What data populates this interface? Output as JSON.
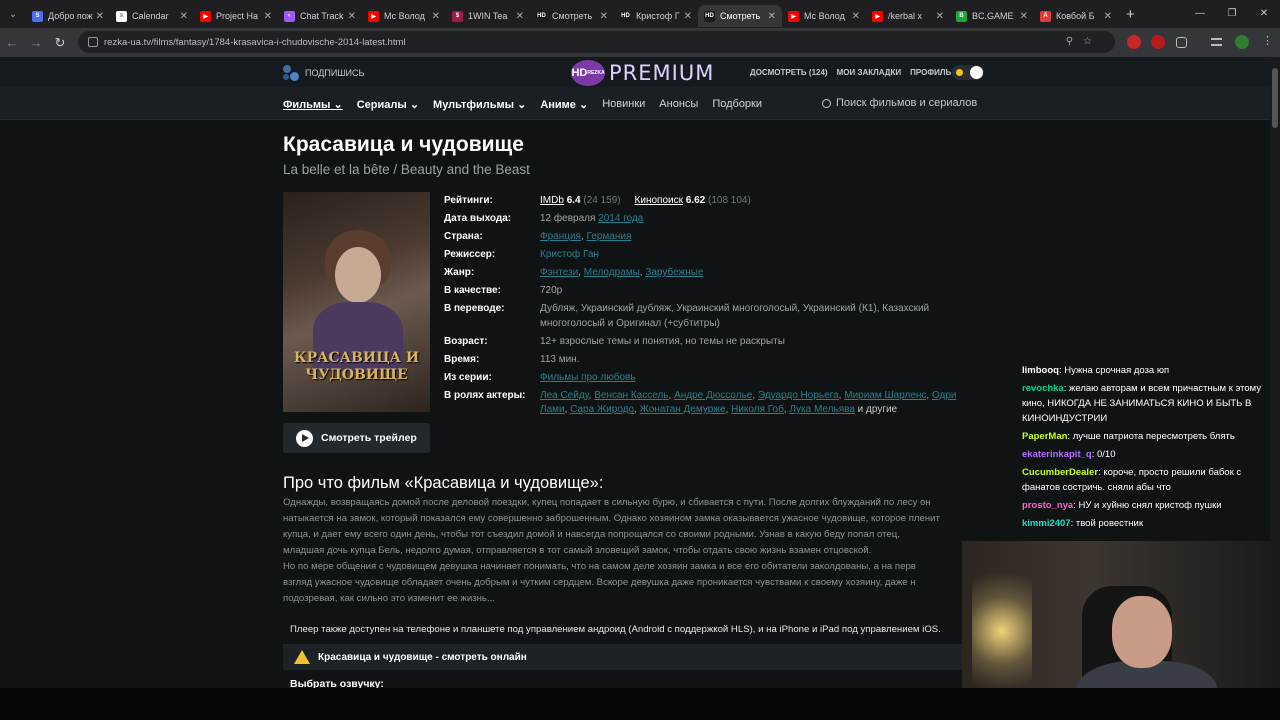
{
  "browser": {
    "tabs": [
      {
        "title": "Добро пож",
        "color": "#4c6ef5",
        "letter": "S"
      },
      {
        "title": "Calendar",
        "color": "#ffffff",
        "letter": "≡"
      },
      {
        "title": "Project Ha",
        "color": "#ff0000",
        "letter": "▶"
      },
      {
        "title": "Chat Track",
        "color": "#9c59ff",
        "letter": "◐"
      },
      {
        "title": "Мс Волод",
        "color": "#ff0000",
        "letter": "▶"
      },
      {
        "title": "1WIN Tea",
        "color": "#9e1b4a",
        "letter": "$"
      },
      {
        "title": "Смотреть",
        "color": "#1a1a1a",
        "letter": "HD"
      },
      {
        "title": "Кристоф Г",
        "color": "#1a1a1a",
        "letter": "HD"
      },
      {
        "title": "Смотреть",
        "color": "#1a1a1a",
        "letter": "HD",
        "active": true
      },
      {
        "title": "Мс Волод",
        "color": "#ff0000",
        "letter": "▶"
      },
      {
        "title": "/kerbal x",
        "color": "#ff0000",
        "letter": "▶"
      },
      {
        "title": "BC.GAME",
        "color": "#1fa83a",
        "letter": "B"
      },
      {
        "title": "Ковбой Б",
        "color": "#e53935",
        "letter": "A"
      }
    ],
    "url": "rezka-ua.tv/films/fantasy/1784-krasavica-i-chudovische-2014-latest.html"
  },
  "site": {
    "subscribe": "ПОДПИШИСЬ",
    "logo_hd": "HD",
    "logo_sub": "REZKA",
    "logo_premium": "PREMIUM",
    "toplinks": [
      "ДОСМОТРЕТЬ (124)",
      "МОИ ЗАКЛАДКИ",
      "ПРОФИЛЬ"
    ],
    "nav": [
      "Фильмы",
      "Сериалы",
      "Мультфильмы",
      "Аниме",
      "Новинки",
      "Анонсы",
      "Подборки"
    ],
    "search_placeholder": "Поиск фильмов и сериалов"
  },
  "movie": {
    "title": "Красавица и чудовище",
    "original_title": "La belle et la bête / Beauty and the Beast",
    "poster_text": "КРАСАВИЦА И ЧУДОВИЩЕ",
    "trailer_btn": "Смотреть трейлер",
    "ratings_label": "Рейтинги:",
    "imdb": {
      "name": "IMDb",
      "score": "6.4",
      "votes": "(24 159)"
    },
    "kinopoisk": {
      "name": "Кинопоиск",
      "score": "6.62",
      "votes": "(108 104)"
    },
    "release_label": "Дата выхода:",
    "release_day": "12 февраля",
    "release_year": "2014 года",
    "country_label": "Страна:",
    "countries": [
      "Франция",
      "Германия"
    ],
    "director_label": "Режиссер:",
    "director": "Кристоф Ган",
    "genre_label": "Жанр:",
    "genres": [
      "Фэнтези",
      "Мелодрамы",
      "Зарубежные"
    ],
    "quality_label": "В качестве:",
    "quality": "720p",
    "translation_label": "В переводе:",
    "translation": "Дубляж, Украинский дубляж, Украинский многоголосый, Украинский (К1), Казахский многоголосый и Оригинал (+субтитры)",
    "age_label": "Возраст:",
    "age": "12+ взрослые темы и понятия, но темы не раскрыты",
    "time_label": "Время:",
    "time": "113 мин.",
    "series_label": "Из серии:",
    "series": "Фильмы про любовь",
    "actors_label": "В ролях актеры:",
    "actors": [
      "Леа Сейду",
      "Венсан Кассель",
      "Андре Дюссолье",
      "Эдуардо Норьега",
      "Мириам Шарленс",
      "Одри Лами",
      "Сара Жиродо",
      "Жонатан Демурже",
      "Николя Гоб",
      "Лука Мельява"
    ],
    "actors_more": "и другие",
    "about_heading": "Про что фильм «Красавица и чудовище»:",
    "description": [
      "Однажды, возвращаясь домой после деловой поездки, купец попадает в сильную бурю, и сбивается с пути. После долгих блужданий по лесу он",
      "натыкается на замок, который показался ему совершенно заброшенным. Однако хозяином замка оказывается ужасное чудовище, которое пленит",
      "купца, и дает ему всего один день, чтобы тот съездил домой и навсегда попрощался со своими родными. Узнав в какую беду попал отец,",
      "младшая дочь купца Бель, недолго думая, отправляется в тот самый зловещий замок, чтобы отдать свою жизнь взамен отцовской.",
      "Но по мере общения с чудовищем девушка начинает понимать, что на самом деле хозяин замка и все его обитатели заколдованы, а на перв",
      "взгляд ужасное чудовище обладает очень добрым и чутким сердцем. Вскоре девушка даже проникается чувствами к своему хозяину, даже н",
      "подозревая, как сильно это изменит ее жизнь..."
    ],
    "player_note": "Плеер также доступен на телефоне и планшете под управлением андроид (Android с поддержкой HLS), и на iPhone и iPad под управлением iOS.",
    "watch_online": "Красавица и чудовище - смотреть онлайн",
    "choose_voice": "Выбрать озвучку:"
  },
  "chat": [
    {
      "user": "limbooq",
      "color": "#ffffff",
      "text": "Нужна срочная доза юп"
    },
    {
      "user": "revochka",
      "color": "#00d38a",
      "text": "желаю авторам и всем причастным к этому кино, НИКОГДА НЕ ЗАНИМАТЬСЯ КИНО И БЫТЬ В КИНОИНДУСТРИИ"
    },
    {
      "user": "PaperMan",
      "color": "#c6ff1a",
      "text": "лучше патриота пересмотреть блять"
    },
    {
      "user": "ekaterinkapit_q",
      "color": "#b46bff",
      "text": "0/10"
    },
    {
      "user": "CucumberDealer",
      "color": "#c6ff1a",
      "text": "короче, просто решили бабок с фанатов состричь. сняли абы что"
    },
    {
      "user": "prosto_nya",
      "color": "#ff5fd2",
      "text": "НУ и хуйню снял кристоф пушки"
    },
    {
      "user": "kimmi2407",
      "color": "#19e0c8",
      "text": "твой ровестник"
    }
  ]
}
